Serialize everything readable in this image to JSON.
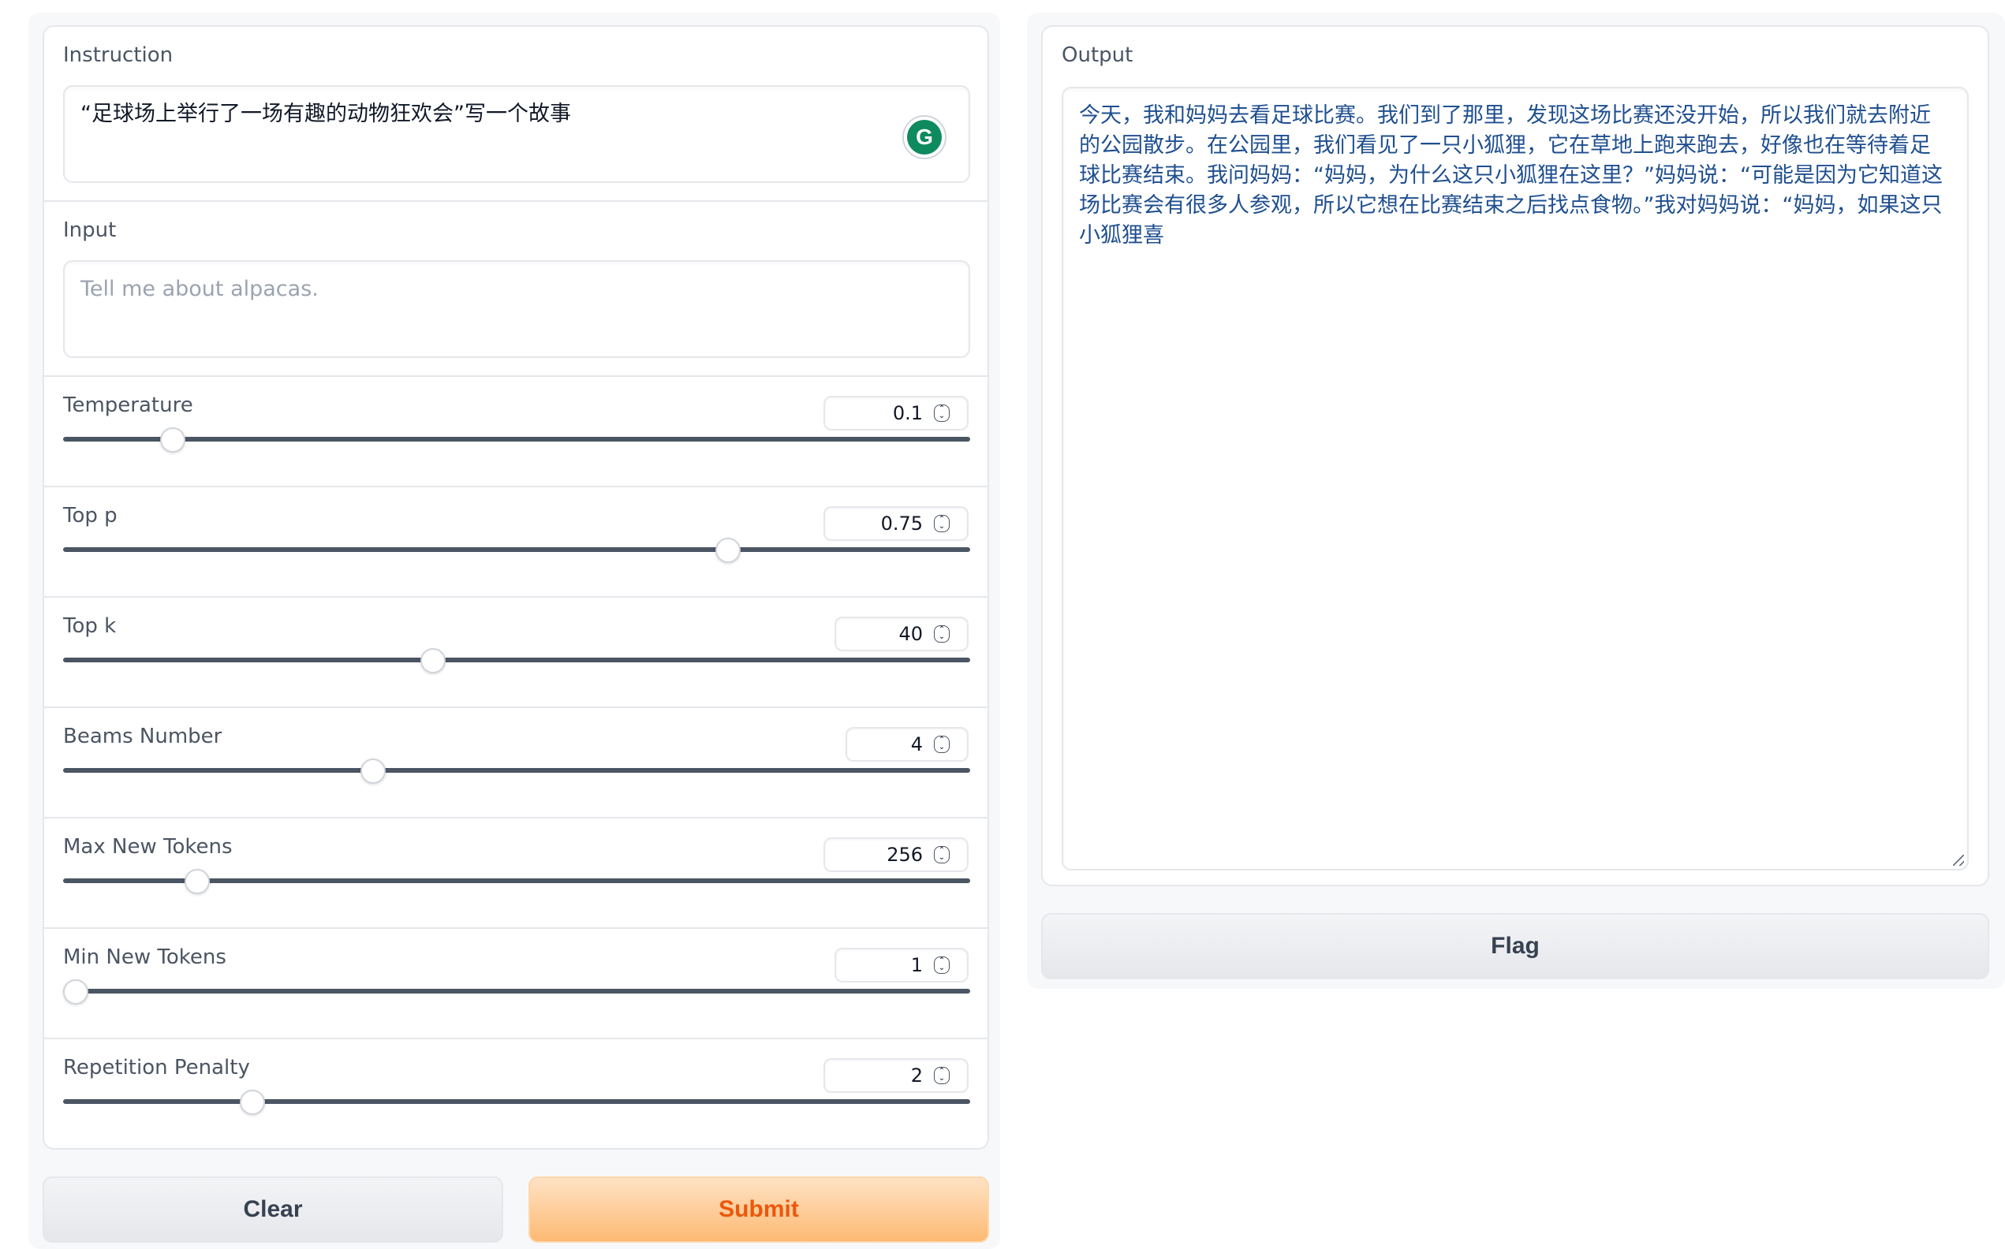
{
  "instruction": {
    "label": "Instruction",
    "value": "“足球场上举行了一场有趣的动物狂欢会”写一个故事",
    "grammarly_letter": "G"
  },
  "input": {
    "label": "Input",
    "placeholder": "Tell me about alpacas."
  },
  "sliders": [
    {
      "label": "Temperature",
      "value": "0.1",
      "fraction": 0.11
    },
    {
      "label": "Top p",
      "value": "0.75",
      "fraction": 0.74
    },
    {
      "label": "Top k",
      "value": "40",
      "fraction": 0.405
    },
    {
      "label": "Beams Number",
      "value": "4",
      "fraction": 0.337
    },
    {
      "label": "Max New Tokens",
      "value": "256",
      "fraction": 0.138
    },
    {
      "label": "Min New Tokens",
      "value": "1",
      "fraction": 0.0
    },
    {
      "label": "Repetition Penalty",
      "value": "2",
      "fraction": 0.2
    }
  ],
  "buttons": {
    "clear": "Clear",
    "submit": "Submit",
    "flag": "Flag"
  },
  "output": {
    "label": "Output",
    "value": "今天，我和妈妈去看足球比赛。我们到了那里，发现这场比赛还没开始，所以我们就去附近的公园散步。在公园里，我们看见了一只小狐狸，它在草地上跑来跑去，好像也在等待着足球比赛结束。我问妈妈：“妈妈，为什么这只小狐狸在这里？”妈妈说：“可能是因为它知道这场比赛会有很多人参观，所以它想在比赛结束之后找点食物。”我对妈妈说：“妈妈，如果这只小狐狸喜"
  },
  "colors": {
    "submit_text": "#ea580c",
    "submit_bg": "#fdba74",
    "output_text": "#1f4f8f",
    "grammarly": "#0e8a5f"
  }
}
